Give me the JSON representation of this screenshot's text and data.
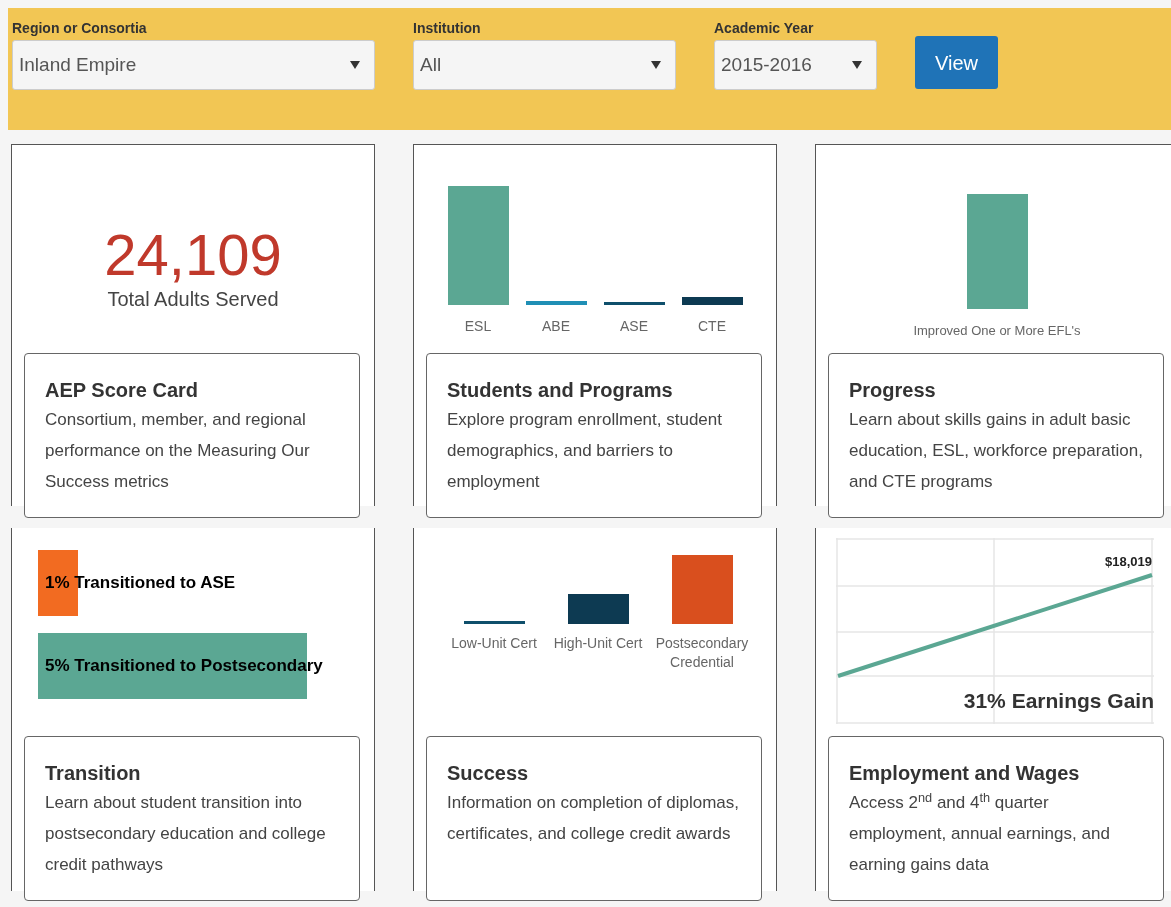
{
  "filters": [
    {
      "label": "Region or Consortia",
      "value": "Inland Empire"
    },
    {
      "label": "Institution",
      "value": "All"
    },
    {
      "label": "Academic Year",
      "value": "2015-2016"
    }
  ],
  "view_button": "View",
  "tiles": [
    {
      "kind": "total",
      "number": "24,109",
      "caption": "Total Adults Served",
      "title": "AEP Score Card",
      "description": "Consortium, member, and regional performance on the Measuring Our Success metrics"
    },
    {
      "kind": "bars",
      "bars": [
        {
          "label": "ESL",
          "color": "#5ba793"
        },
        {
          "label": "ABE",
          "color": "#1f8fb5"
        },
        {
          "label": "ASE",
          "color": "#0f4f6b"
        },
        {
          "label": "CTE",
          "color": "#0d3a52"
        }
      ],
      "title": "Students and Programs",
      "description": "Explore program enrollment, student demographics, and barriers to employment"
    },
    {
      "kind": "single",
      "bars": [
        {
          "label": "Improved One or More EFL's",
          "color": "#5ba793"
        }
      ],
      "title": "Progress",
      "description": "Learn about skills gains in adult basic education, ESL, workforce preparation, and CTE programs"
    },
    {
      "kind": "transition",
      "bars": [
        {
          "label": "1% Transitioned to ASE",
          "color": "#f26b21"
        },
        {
          "label": "5% Transitioned to Postsecondary",
          "color": "#5ba793"
        }
      ],
      "title": "Transition",
      "description": "Learn about student transition into postsecondary education and college credit pathways"
    },
    {
      "kind": "bars3",
      "bars": [
        {
          "label": "Low-Unit Cert",
          "color": "#0f4f6b"
        },
        {
          "label": "High-Unit Cert",
          "color": "#0d3a52"
        },
        {
          "label": "Postsecondary Credential",
          "color": "#d94f1e"
        }
      ],
      "title": "Success",
      "description": "Information on completion of diplomas, certificates, and college credit awards"
    },
    {
      "kind": "line",
      "value_label": "$18,019",
      "gain": "31% Earnings Gain",
      "title": "Employment and Wages",
      "description": "Access 2$^{nd}$ and 4$^{th}$ quarter employment, annual earnings, and earning gains data"
    }
  ]
}
